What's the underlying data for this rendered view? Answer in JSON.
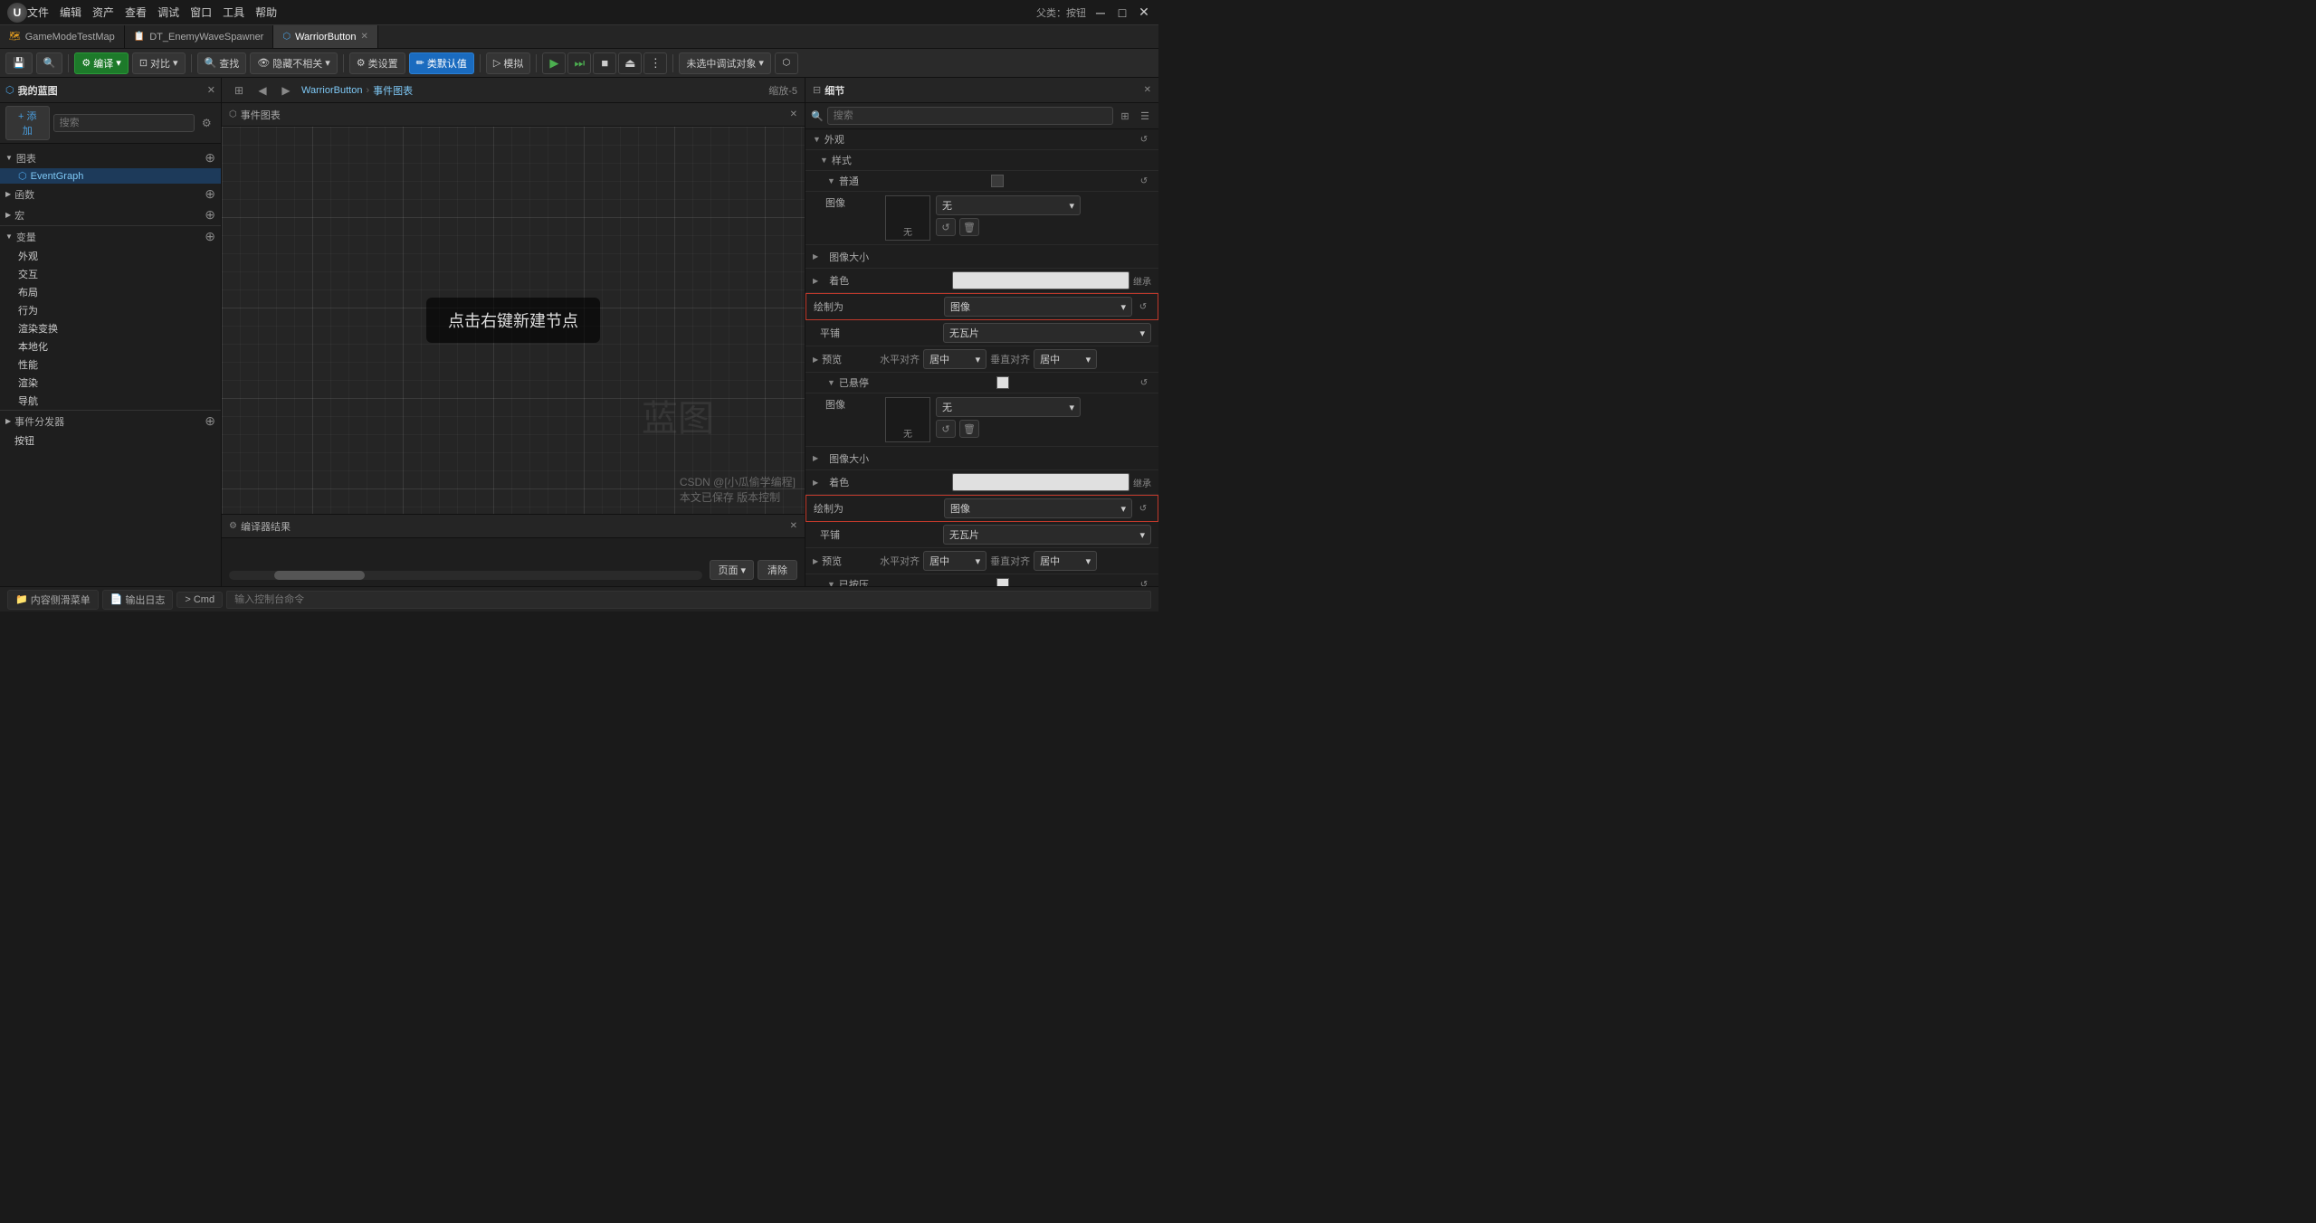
{
  "app": {
    "title": "Unreal Engine",
    "logo_text": "U"
  },
  "menu": {
    "items": [
      "文件",
      "编辑",
      "资产",
      "查看",
      "调试",
      "窗口",
      "工具",
      "帮助"
    ]
  },
  "tabs": [
    {
      "id": "gamemode",
      "label": "GameModeTestMap",
      "icon": "map-icon",
      "active": false,
      "closable": false
    },
    {
      "id": "enemywave",
      "label": "DT_EnemyWaveSpawner",
      "icon": "datatable-icon",
      "active": false,
      "closable": false
    },
    {
      "id": "warrior",
      "label": "WarriorButton",
      "icon": "blueprint-icon",
      "active": true,
      "closable": true
    }
  ],
  "toolbar": {
    "compile_label": "编译",
    "compare_label": "对比",
    "find_label": "查找",
    "hide_unrelated_label": "隐藏不相关",
    "class_settings_label": "类设置",
    "class_defaults_label": "类默认值",
    "simulate_label": "模拟",
    "debug_target_label": "未选中调试对象",
    "parent_class_label": "父类：按钮"
  },
  "left_panel": {
    "title": "我的蓝图",
    "add_label": "+ 添加",
    "search_placeholder": "搜索",
    "sections": {
      "graph": "图表",
      "event_graph": "EventGraph",
      "functions_label": "函数",
      "macros_label": "宏",
      "variables_label": "变量",
      "var_items": [
        "外观",
        "交互",
        "布局",
        "行为",
        "渲染变换",
        "本地化",
        "性能",
        "渲染",
        "导航"
      ],
      "event_dispatchers_label": "事件分发器",
      "button_label": "按钮"
    }
  },
  "event_graph": {
    "title": "事件图表",
    "breadcrumb_root": "WarriorButton",
    "breadcrumb_sep": "›",
    "breadcrumb_current": "事件图表",
    "zoom_label": "缩放-5",
    "hint": "点击右键新建节点",
    "watermark": "蓝图"
  },
  "compiler": {
    "title": "编译器结果",
    "page_label": "页面",
    "clear_label": "清除"
  },
  "detail_panel": {
    "title": "细节",
    "search_placeholder": "搜索",
    "sections": {
      "appearance": "外观",
      "style": "样式",
      "normal": "普通",
      "image_label": "图像",
      "image_none": "无",
      "image_size_label": "图像大小",
      "tint_label": "着色",
      "tint_inherit": "继承",
      "draw_as_label": "绘制为",
      "draw_as_value": "图像",
      "tiling_label": "平铺",
      "tiling_value": "无瓦片",
      "preview_label": "预览",
      "h_align_label": "水平对齐",
      "h_align_value": "居中",
      "v_align_label": "垂直对齐",
      "v_align_value": "居中",
      "hovered_label": "已悬停",
      "pressed_label": "已按压"
    }
  },
  "bottom_bar": {
    "content_browser_label": "内容侧滑菜单",
    "output_log_label": "输出日志",
    "cmd_label": "Cmd",
    "cmd_placeholder": "输入控制台命令"
  },
  "watermark_text": "蓝图",
  "copyright": "CSDN @[小瓜偷学编程]",
  "copyright2": "本文已保存  版本控制"
}
